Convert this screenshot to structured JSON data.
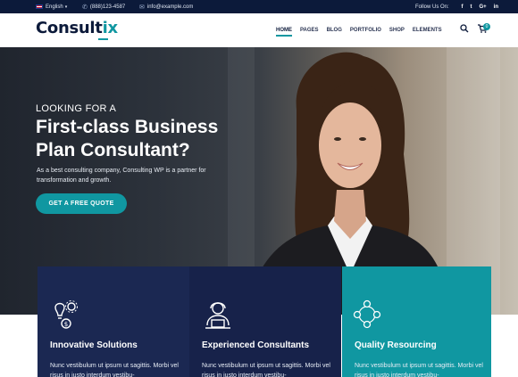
{
  "topbar": {
    "language": "English",
    "phone": "(888)123-4587",
    "email": "info@example.com",
    "follow_label": "Follow Us On:",
    "social": [
      "f",
      "t",
      "G+",
      "in"
    ]
  },
  "header": {
    "logo_main": "Consult",
    "logo_accent": "ix",
    "nav": [
      "HOME",
      "PAGES",
      "BLOG",
      "PORTFOLIO",
      "SHOP",
      "ELEMENTS"
    ],
    "cart_count": "0"
  },
  "hero": {
    "kicker": "LOOKING FOR A",
    "title": "First-class Business Plan Consultant?",
    "description": "As a best consulting company, Consulting WP is a partner for transformation and  growth.",
    "cta": "GET A FREE QUOTE"
  },
  "features": [
    {
      "title": "Innovative Solutions",
      "text": "Nunc vestibulum ut ipsum ut sagittis. Morbi vel risus in justo interdum vestibu-",
      "icon": "lightbulb-gear-icon"
    },
    {
      "title": "Experienced Consultants",
      "text": "Nunc vestibulum ut ipsum ut sagittis. Morbi vel risus in justo interdum vestibu-",
      "icon": "consultant-laptop-icon"
    },
    {
      "title": "Quality Resourcing",
      "text": "Nunc vestibulum ut ipsum ut sagittis. Morbi vel risus in justo interdum vestibu-",
      "icon": "people-network-icon"
    }
  ],
  "colors": {
    "navy": "#0c1a3a",
    "teal": "#1097a1",
    "feature1": "#1b2852",
    "feature2": "#17224a"
  }
}
